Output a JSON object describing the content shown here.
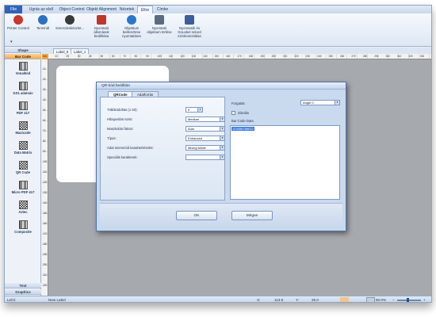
{
  "menu": {
    "file": "File",
    "tabs": [
      "Ugrás az első rekordra",
      "Object Control",
      "Objekt Alignment",
      "Nézetek",
      "Eltre",
      "Címke"
    ],
    "active_tab_index": 4
  },
  "ribbon": {
    "buttons": [
      {
        "label": "Printer Control",
        "icon": "printer-icon",
        "color": "#c8382f"
      },
      {
        "label": "Terminál",
        "icon": "terminal-icon",
        "color": "#2f6fbf"
      },
      {
        "label": "Szerszámkészlet...",
        "icon": "toolkit-icon",
        "color": "#3a3a3a"
      },
      {
        "label": "Nyomtató állomások beállítása",
        "icon": "printer-settings-icon",
        "color": "#c0352c"
      },
      {
        "label": "Objektum beillesztése nyomtatásra",
        "icon": "globe-icon",
        "color": "#2a77c9"
      },
      {
        "label": "Nyomtató objektum törlése",
        "icon": "printer-delete-icon",
        "color": "#5c6b80"
      },
      {
        "label": "Nyomtatók és GoLabel rekord szinkronizálása",
        "icon": "sync-icon",
        "color": "#3c5f9a"
      }
    ],
    "collapse_arrow": "▾"
  },
  "sidebar": {
    "shape_header": "Shape",
    "barcode_header": "Bar Code",
    "items": [
      {
        "label": "Vonalkód",
        "kind": "linear"
      },
      {
        "label": "GS1 adatsáv",
        "kind": "linear"
      },
      {
        "label": "PDF 417",
        "kind": "linear"
      },
      {
        "label": "Maxicode",
        "kind": "matrix"
      },
      {
        "label": "Data Matrix",
        "kind": "matrix"
      },
      {
        "label": "QR Code",
        "kind": "matrix"
      },
      {
        "label": "Micro PDF 417",
        "kind": "linear"
      },
      {
        "label": "Aztec",
        "kind": "matrix"
      },
      {
        "label": "Composite",
        "kind": "linear"
      }
    ],
    "text_header": "Text",
    "graphics_header": "Graphics"
  },
  "doc_tabs": [
    "Label_0",
    "Label_1"
  ],
  "ruler": {
    "corner": "mm",
    "h_ticks": [
      "10",
      "20",
      "30",
      "40",
      "50",
      "60",
      "70",
      "80",
      "90",
      "100",
      "110",
      "120",
      "130",
      "140",
      "150",
      "160",
      "170",
      "180",
      "190",
      "200",
      "210",
      "220",
      "230",
      "240",
      "250",
      "260",
      "270",
      "280",
      "290",
      "300",
      "310",
      "320",
      "330"
    ],
    "v_ticks": [
      "10",
      "20",
      "30",
      "40",
      "50",
      "60",
      "70",
      "80",
      "90",
      "100",
      "110",
      "120",
      "130",
      "140",
      "150",
      "160",
      "170",
      "180",
      "190",
      "200",
      "210",
      "220"
    ]
  },
  "dialog": {
    "title": "QR-kód beállítás",
    "tabs": [
      "QRCode",
      "Adatforrás"
    ],
    "active_tab": 0,
    "fields": [
      {
        "label": "Többkódoltás (1-40):",
        "value": "0",
        "type": "spinner"
      },
      {
        "label": "Hibajavítási szint:",
        "value": "Medium",
        "type": "select"
      },
      {
        "label": "Maszkolási faktor:",
        "value": "Auto",
        "type": "select"
      },
      {
        "label": "Típus:",
        "value": "Enhanced",
        "type": "select"
      },
      {
        "label": "Adat üzemmód karakterkészlet:",
        "value": "Mixing Mode",
        "type": "select"
      },
      {
        "label": "Speciális karakterek:",
        "value": "",
        "type": "select"
      }
    ],
    "rotation_label": "Forgatás:",
    "rotation_value": "Angle 0",
    "locked_label": "Zárolás",
    "barcode_data_label": "Bar Code Data",
    "barcode_data_value": "123456789012",
    "ok_button": "OK",
    "cancel_button": "Mégse"
  },
  "statusbar": {
    "left": "Leíró",
    "label_name": "New Label",
    "x_label": "X:",
    "x_value": "113.5",
    "y_label": "Y:",
    "y_value": "25.0",
    "zoom": "50.0%",
    "swatch_color": "#f3c48b"
  }
}
